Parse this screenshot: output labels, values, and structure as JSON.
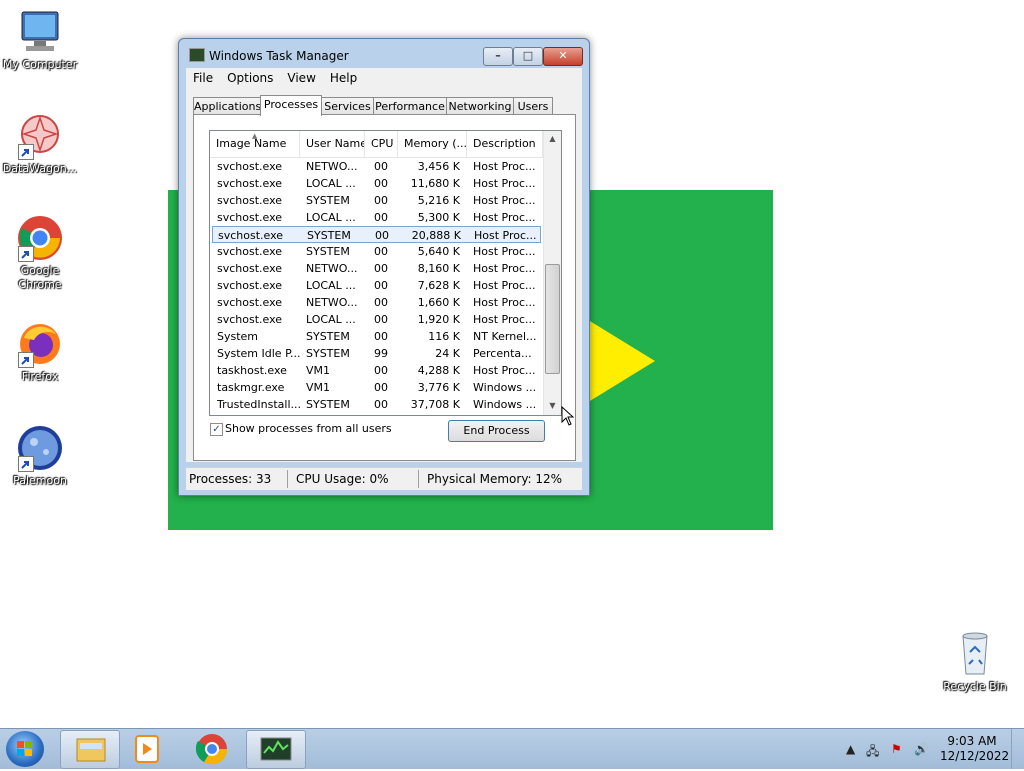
{
  "desktop": {
    "icons": [
      {
        "label": "My Computer",
        "icon": "computer-icon"
      },
      {
        "label": "DataWagon...",
        "icon": "datawagon-icon"
      },
      {
        "label": "Google Chrome",
        "icon": "chrome-icon"
      },
      {
        "label": "Firefox",
        "icon": "firefox-icon"
      },
      {
        "label": "Palemoon",
        "icon": "palemoon-icon"
      },
      {
        "label": "Recycle Bin",
        "icon": "recycle-bin-icon"
      }
    ],
    "background_shape_color": "#22b14c",
    "triangle_color": "#ffee00"
  },
  "window": {
    "title": "Windows Task Manager",
    "menu": [
      "File",
      "Options",
      "View",
      "Help"
    ],
    "tabs": [
      "Applications",
      "Processes",
      "Services",
      "Performance",
      "Networking",
      "Users"
    ],
    "active_tab": "Processes",
    "columns": [
      "Image Name",
      "User Name",
      "CPU",
      "Memory (...",
      "Description"
    ],
    "rows": [
      {
        "image": "svchost.exe",
        "user": "NETWO...",
        "cpu": "00",
        "mem": "3,456 K",
        "desc": "Host Proc..."
      },
      {
        "image": "svchost.exe",
        "user": "LOCAL ...",
        "cpu": "00",
        "mem": "11,680 K",
        "desc": "Host Proc..."
      },
      {
        "image": "svchost.exe",
        "user": "SYSTEM",
        "cpu": "00",
        "mem": "5,216 K",
        "desc": "Host Proc..."
      },
      {
        "image": "svchost.exe",
        "user": "LOCAL ...",
        "cpu": "00",
        "mem": "5,300 K",
        "desc": "Host Proc..."
      },
      {
        "image": "svchost.exe",
        "user": "SYSTEM",
        "cpu": "00",
        "mem": "20,888 K",
        "desc": "Host Proc...",
        "selected": true
      },
      {
        "image": "svchost.exe",
        "user": "SYSTEM",
        "cpu": "00",
        "mem": "5,640 K",
        "desc": "Host Proc..."
      },
      {
        "image": "svchost.exe",
        "user": "NETWO...",
        "cpu": "00",
        "mem": "8,160 K",
        "desc": "Host Proc..."
      },
      {
        "image": "svchost.exe",
        "user": "LOCAL ...",
        "cpu": "00",
        "mem": "7,628 K",
        "desc": "Host Proc..."
      },
      {
        "image": "svchost.exe",
        "user": "NETWO...",
        "cpu": "00",
        "mem": "1,660 K",
        "desc": "Host Proc..."
      },
      {
        "image": "svchost.exe",
        "user": "LOCAL ...",
        "cpu": "00",
        "mem": "1,920 K",
        "desc": "Host Proc..."
      },
      {
        "image": "System",
        "user": "SYSTEM",
        "cpu": "00",
        "mem": "116 K",
        "desc": "NT Kernel..."
      },
      {
        "image": "System Idle P...",
        "user": "SYSTEM",
        "cpu": "99",
        "mem": "24 K",
        "desc": "Percenta..."
      },
      {
        "image": "taskhost.exe",
        "user": "VM1",
        "cpu": "00",
        "mem": "4,288 K",
        "desc": "Host Proc..."
      },
      {
        "image": "taskmgr.exe",
        "user": "VM1",
        "cpu": "00",
        "mem": "3,776 K",
        "desc": "Windows ..."
      },
      {
        "image": "TrustedInstall...",
        "user": "SYSTEM",
        "cpu": "00",
        "mem": "37,708 K",
        "desc": "Windows ..."
      }
    ],
    "show_all_users_label": "Show processes from all users",
    "show_all_users_checked": true,
    "end_process_label": "End Process",
    "status": {
      "processes": "Processes: 33",
      "cpu": "CPU Usage: 0%",
      "memory": "Physical Memory: 12%"
    }
  },
  "taskbar": {
    "time": "9:03 AM",
    "date": "12/12/2022",
    "pinned": [
      "explorer-icon",
      "media-player-icon",
      "chrome-icon",
      "task-manager-icon"
    ]
  }
}
